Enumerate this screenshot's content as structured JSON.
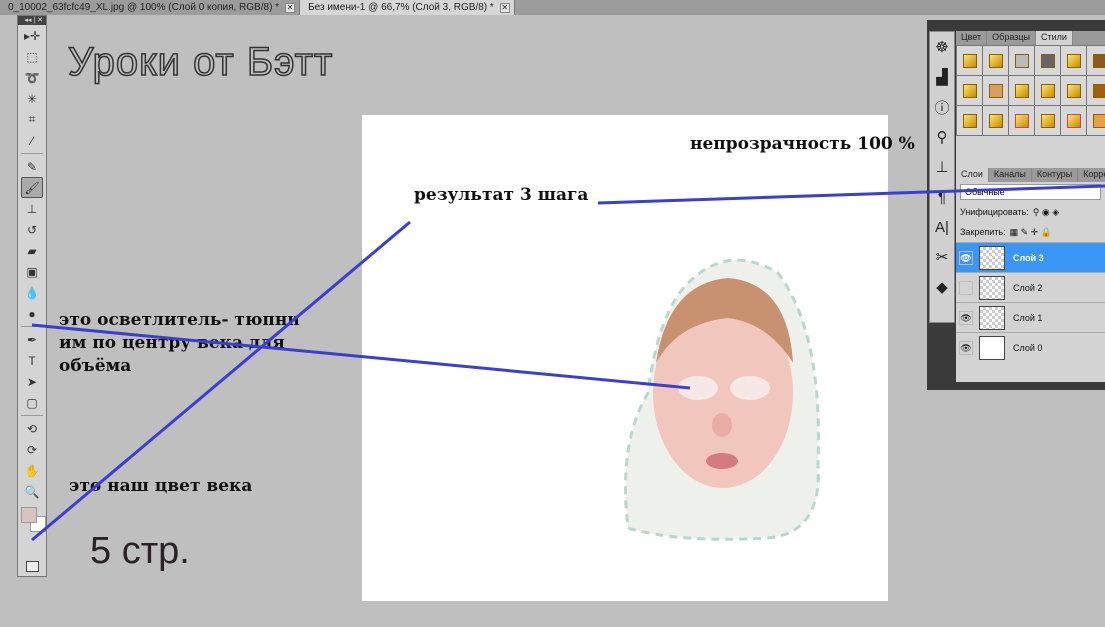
{
  "tabs": [
    {
      "label": "0_10002_63fcfc49_XL.jpg @ 100% (Слой 0 копия, RGB/8) *",
      "active": false
    },
    {
      "label": "Без имени-1 @ 66,7% (Слой 3, RGB/8) *",
      "active": true
    }
  ],
  "close_glyph": "✕",
  "toolbar": {
    "collapse": "◂◂ | ✕",
    "tools": [
      "move-tool",
      "marquee-tool",
      "lasso-tool",
      "magic-wand-tool",
      "crop-tool",
      "eyedropper-tool",
      "healing-brush-tool",
      "brush-tool",
      "clone-stamp-tool",
      "history-brush-tool",
      "eraser-tool",
      "gradient-tool",
      "blur-tool",
      "dodge-tool",
      "pen-tool",
      "type-tool",
      "path-selection-tool",
      "shape-tool",
      "3d-rotate-tool",
      "3d-orbit-tool",
      "hand-tool",
      "zoom-tool"
    ],
    "foreground_color": "#d9c3c0",
    "background_color": "#ffffff"
  },
  "annotations": {
    "title": "Уроки от Бэтт",
    "opacity": "непрозрачность 100 %",
    "result": "результат 3 шага",
    "dodge_note": "это осветлитель- тюпни им по центру века для объёма",
    "color_note": "это наш цвет века",
    "page": "5 стр."
  },
  "line_color": "#3a3fd0",
  "panels": {
    "style_tabs": [
      "Цвет",
      "Образцы",
      "Стили"
    ],
    "layer_tabs": [
      "Слои",
      "Каналы",
      "Контуры",
      "Корре"
    ],
    "blend_mode": "Обычные",
    "unify_label": "Унифицировать:",
    "lock_label": "Закрепить:",
    "layers": [
      {
        "name": "Слой 3",
        "visible": true,
        "selected": true
      },
      {
        "name": "Слой 2",
        "visible": false,
        "selected": false
      },
      {
        "name": "Слой 1",
        "visible": true,
        "selected": false
      },
      {
        "name": "Слой 0",
        "visible": true,
        "selected": false
      }
    ]
  }
}
